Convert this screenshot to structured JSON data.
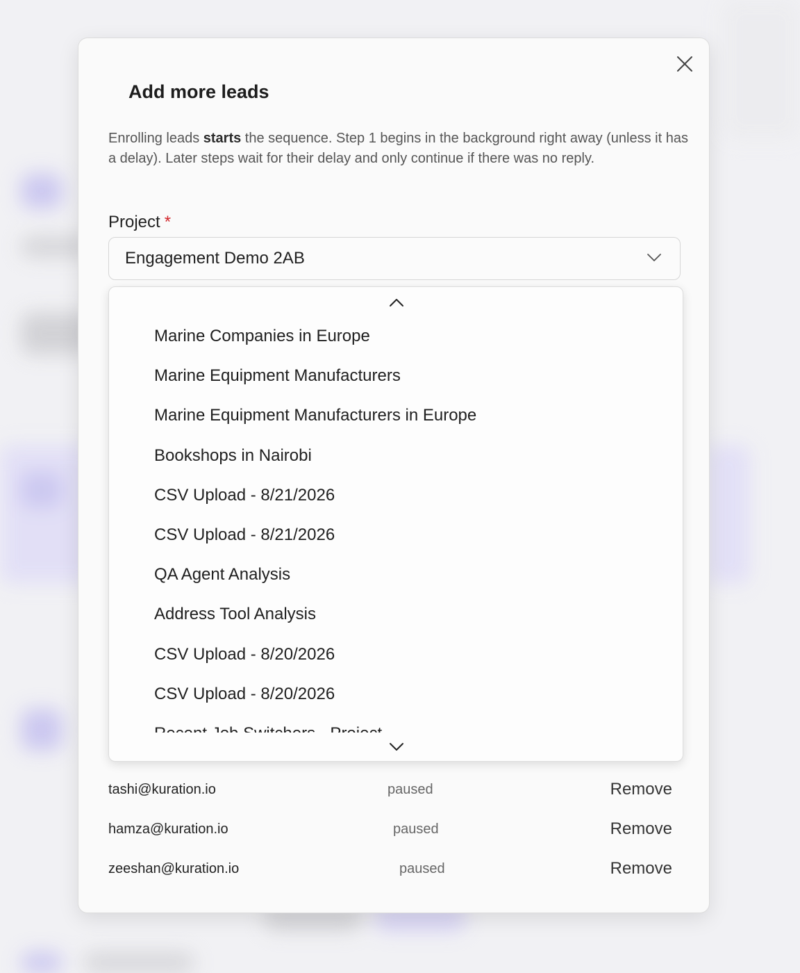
{
  "modal": {
    "title": "Add more leads",
    "description_parts": {
      "before": "Enrolling leads ",
      "bold": "starts",
      "after": " the sequence. Step 1 begins in the background right away (unless it has a delay). Later steps wait for their delay and only continue if there was no reply."
    },
    "project_field": {
      "label": "Project",
      "required_marker": "*",
      "selected_value": "Engagement Demo 2AB"
    },
    "dropdown_options": [
      "Marine Companies in Europe",
      "Marine Equipment Manufacturers",
      "Marine Equipment Manufacturers in Europe",
      "Bookshops in Nairobi",
      "CSV Upload - 8/21/2026",
      "CSV Upload - 8/21/2026",
      "QA Agent Analysis",
      "Address Tool Analysis",
      "CSV Upload - 8/20/2026",
      "CSV Upload - 8/20/2026",
      "Recent Job Switchers - Project"
    ],
    "leads": [
      {
        "email": "tashi@kuration.io",
        "status": "paused",
        "action": "Remove"
      },
      {
        "email": "hamza@kuration.io",
        "status": "paused",
        "action": "Remove"
      },
      {
        "email": "zeeshan@kuration.io",
        "status": "paused",
        "action": "Remove"
      }
    ]
  },
  "icons": {
    "close": "close-icon",
    "select_chevron": "chevron-down-icon",
    "scroll_up": "chevron-up-icon",
    "scroll_down": "chevron-down-icon"
  },
  "colors": {
    "required": "#d2262b",
    "modal_bg": "#fafafa"
  }
}
